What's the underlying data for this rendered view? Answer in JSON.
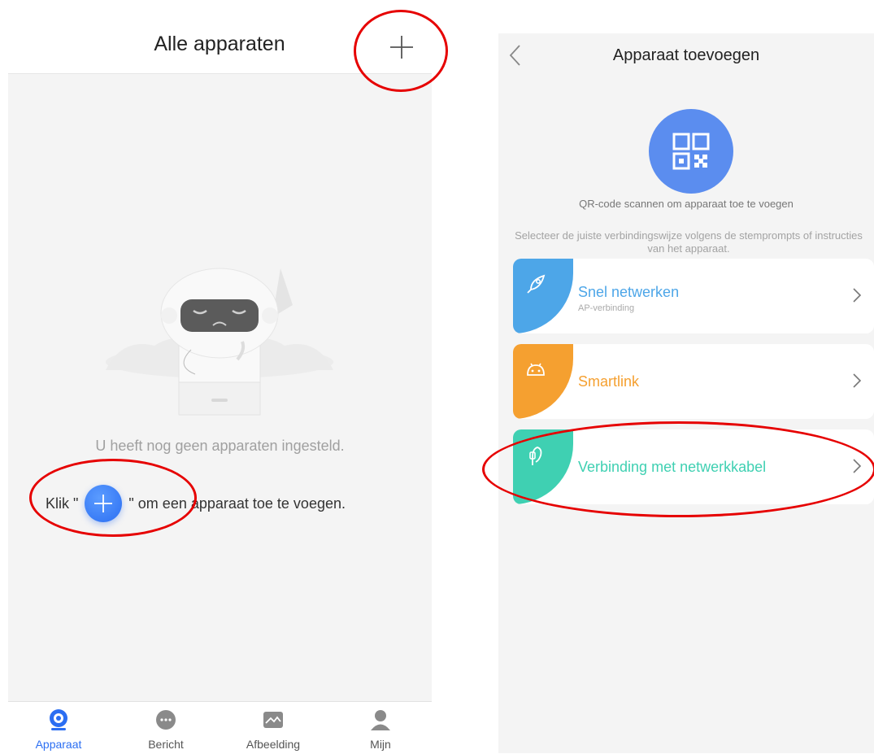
{
  "left_screen": {
    "title": "Alle apparaten",
    "empty_message": "U heeft nog geen apparaten ingesteld.",
    "click_prefix": "Klik \"",
    "click_suffix": "\" om een apparaat toe te voegen.",
    "tabs": [
      {
        "label": "Apparaat",
        "icon": "camera-icon",
        "active": true
      },
      {
        "label": "Bericht",
        "icon": "message-icon",
        "active": false
      },
      {
        "label": "Afbeelding",
        "icon": "image-icon",
        "active": false
      },
      {
        "label": "Mijn",
        "icon": "person-icon",
        "active": false
      }
    ]
  },
  "right_screen": {
    "title": "Apparaat toevoegen",
    "qr_caption": "QR-code scannen om apparaat toe te voegen",
    "instructions": "Selecteer de juiste verbindingswijze volgens de stemprompts of instructies van het apparaat.",
    "options": [
      {
        "title": "Snel netwerken",
        "subtitle": "AP-verbinding",
        "icon": "rocket-icon",
        "color": "#4da6e8"
      },
      {
        "title": "Smartlink",
        "subtitle": "",
        "icon": "android-icon",
        "color": "#f5a030"
      },
      {
        "title": "Verbinding met netwerkkabel",
        "subtitle": "",
        "icon": "cable-icon",
        "color": "#3fd0b2"
      }
    ]
  },
  "colors": {
    "accent": "#2b6ef2",
    "annotation": "#e60000"
  }
}
